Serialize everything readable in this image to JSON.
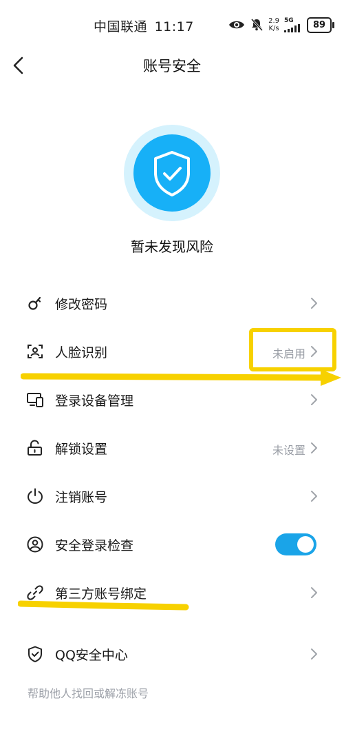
{
  "status_bar": {
    "carrier": "中国联通",
    "time": "11:17",
    "speed_value": "2.9",
    "speed_unit": "K/s",
    "network": "5G",
    "battery": "89"
  },
  "nav": {
    "title": "账号安全"
  },
  "status": {
    "text": "暂未发现风险"
  },
  "menu": [
    {
      "label": "修改密码",
      "icon": "key-icon"
    },
    {
      "label": "人脸识别",
      "hint": "未启用",
      "icon": "face-scan-icon"
    },
    {
      "label": "登录设备管理",
      "icon": "devices-icon"
    },
    {
      "label": "解锁设置",
      "hint": "未设置",
      "icon": "unlock-icon"
    },
    {
      "label": "注销账号",
      "icon": "power-icon"
    },
    {
      "label": "安全登录检查",
      "toggle_on": true,
      "icon": "user-circle-icon"
    },
    {
      "label": "第三方账号绑定",
      "icon": "link-icon"
    },
    {
      "label": "QQ安全中心",
      "icon": "shield-icon"
    }
  ],
  "footer": {
    "link": "帮助他人找回或解冻账号"
  },
  "colors": {
    "accent": "#17b0f7",
    "toggle": "#1aa4e8",
    "annotation": "#f7d100"
  }
}
